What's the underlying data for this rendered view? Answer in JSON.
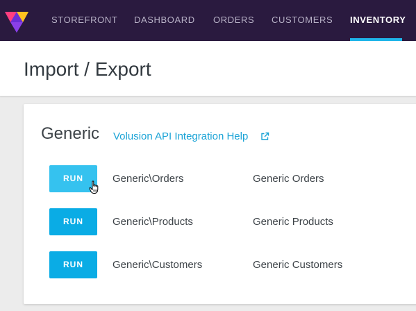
{
  "nav": {
    "items": [
      {
        "label": "STOREFRONT"
      },
      {
        "label": "DASHBOARD"
      },
      {
        "label": "ORDERS"
      },
      {
        "label": "CUSTOMERS"
      },
      {
        "label": "INVENTORY",
        "active": true
      }
    ],
    "accent_color": "#1fb4e9",
    "background_color": "#2a1a3f"
  },
  "header": {
    "title": "Import / Export"
  },
  "card": {
    "title": "Generic",
    "help_link": "Volusion API Integration Help",
    "help_link_icon": "external-link-icon",
    "rows": [
      {
        "button": "RUN",
        "path": "Generic\\Orders",
        "name": "Generic Orders"
      },
      {
        "button": "RUN",
        "path": "Generic\\Products",
        "name": "Generic Products"
      },
      {
        "button": "RUN",
        "path": "Generic\\Customers",
        "name": "Generic Customers"
      }
    ],
    "button_color": "#0aace5"
  }
}
